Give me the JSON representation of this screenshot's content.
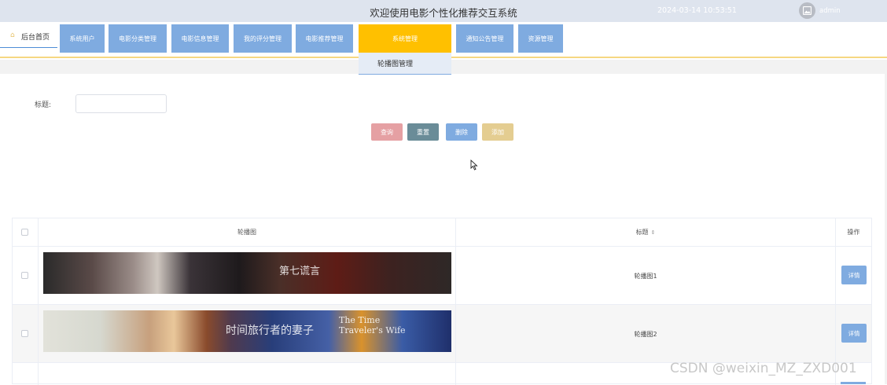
{
  "header": {
    "title": "欢迎使用电影个性化推荐交互系统",
    "datetime": "2024-03-14 10:53:51",
    "username": "admin"
  },
  "nav": {
    "home_label": "后台首页",
    "items": [
      {
        "label": "系统用户"
      },
      {
        "label": "电影分类管理"
      },
      {
        "label": "电影信息管理"
      },
      {
        "label": "我的评分管理"
      },
      {
        "label": "电影推荐管理"
      },
      {
        "label": "系统管理"
      },
      {
        "label": "通知公告管理"
      },
      {
        "label": "资源管理"
      }
    ],
    "active": "系统管理",
    "dropdown_items": [
      {
        "label": "轮播图管理"
      }
    ]
  },
  "search": {
    "title_label": "标题:",
    "title_value": "",
    "buttons": {
      "query": "查询",
      "reset": "重置",
      "delete": "删除",
      "add": "添加"
    }
  },
  "table": {
    "columns": [
      "轮播图",
      "标题",
      "操作"
    ],
    "rows": [
      {
        "title": "轮播图1",
        "action": "详情",
        "banner_text": "第七谎言"
      },
      {
        "title": "轮播图2",
        "action": "详情",
        "banner_text": "时间旅行者的妻子",
        "banner_text_en": "The Time Traveler's Wife"
      }
    ]
  },
  "colors": {
    "header_bg": "#dee4ee",
    "nav_btn": "#7fabe0",
    "nav_active": "#ffc000",
    "query_btn": "#e5a0a3",
    "reset_btn": "#6a8c98",
    "delete_btn": "#7fabe0",
    "add_btn": "#e4cd91"
  },
  "watermark": "CSDN @weixin_MZ_ZXD001"
}
